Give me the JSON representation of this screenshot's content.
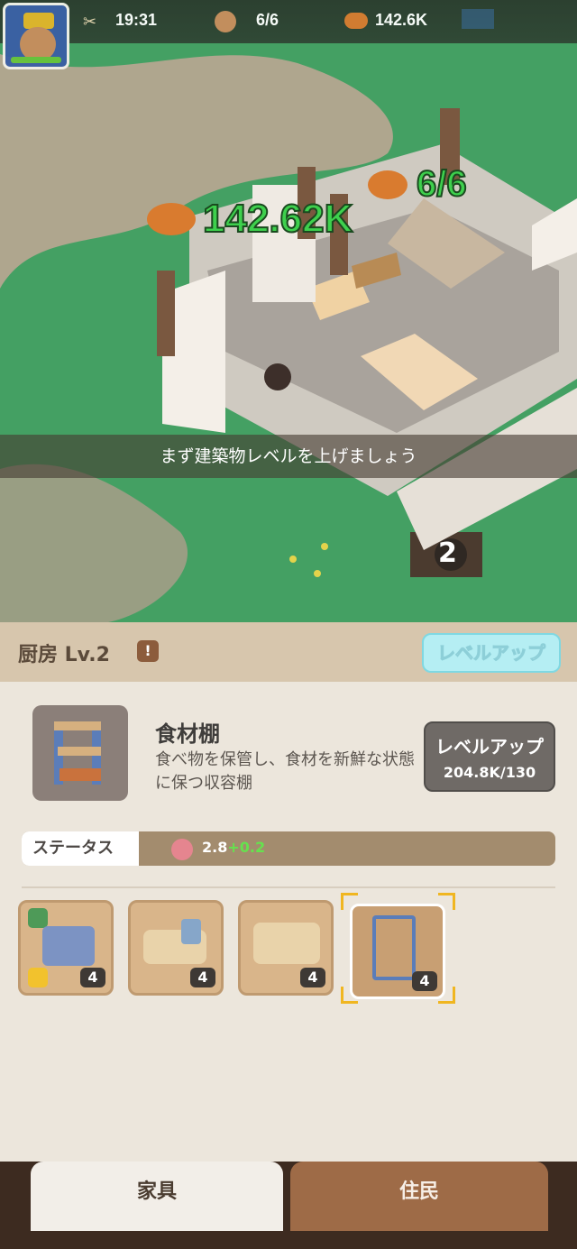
{
  "hud": {
    "time": "19:31",
    "population": "6/6",
    "bread": "142.6K"
  },
  "scene": {
    "bread_amount": "142.62K",
    "population_overlay": "6/6",
    "banner_text": "まず建築物レベルを上げましょう",
    "building_number": "2"
  },
  "panel": {
    "title": "厨房 Lv.2",
    "warning": "!",
    "top_button": "レベルアップ",
    "item_name": "食材棚",
    "item_desc": "食べ物を保管し、食材を新鮮な状態に保つ収容棚",
    "level_up_label": "レベルアップ",
    "level_up_cost": "204.8K/130",
    "status_label": "ステータス",
    "status_value": "2.8",
    "status_bonus": "+0.2"
  },
  "cards": [
    {
      "count": "4"
    },
    {
      "count": "4"
    },
    {
      "count": "4"
    },
    {
      "count": "4"
    }
  ],
  "tabs": {
    "furniture": "家具",
    "residents": "住民"
  },
  "colors": {
    "accent_green": "#3ed04d",
    "selected_frame": "#f0b620"
  }
}
